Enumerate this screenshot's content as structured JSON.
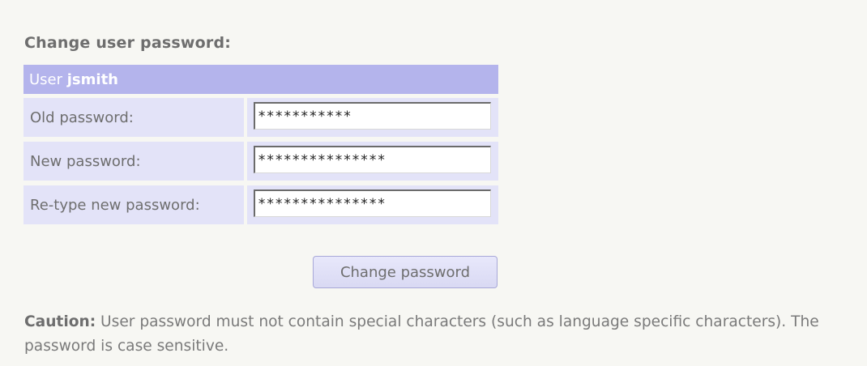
{
  "form": {
    "heading": "Change user password:",
    "user_prefix": "User",
    "username": "jsmith",
    "fields": [
      {
        "label": "Old password:",
        "value": "***********"
      },
      {
        "label": "New password:",
        "value": "***************"
      },
      {
        "label": "Re-type new password:",
        "value": "***************"
      }
    ],
    "submit_label": "Change password"
  },
  "caution": {
    "title": "Caution:",
    "text": " User password must not contain special characters (such as language specific characters). The password is case sensitive."
  },
  "colors": {
    "header_bg": "#b4b4ec",
    "row_bg": "#e3e3f8",
    "page_bg": "#f7f7f3"
  }
}
